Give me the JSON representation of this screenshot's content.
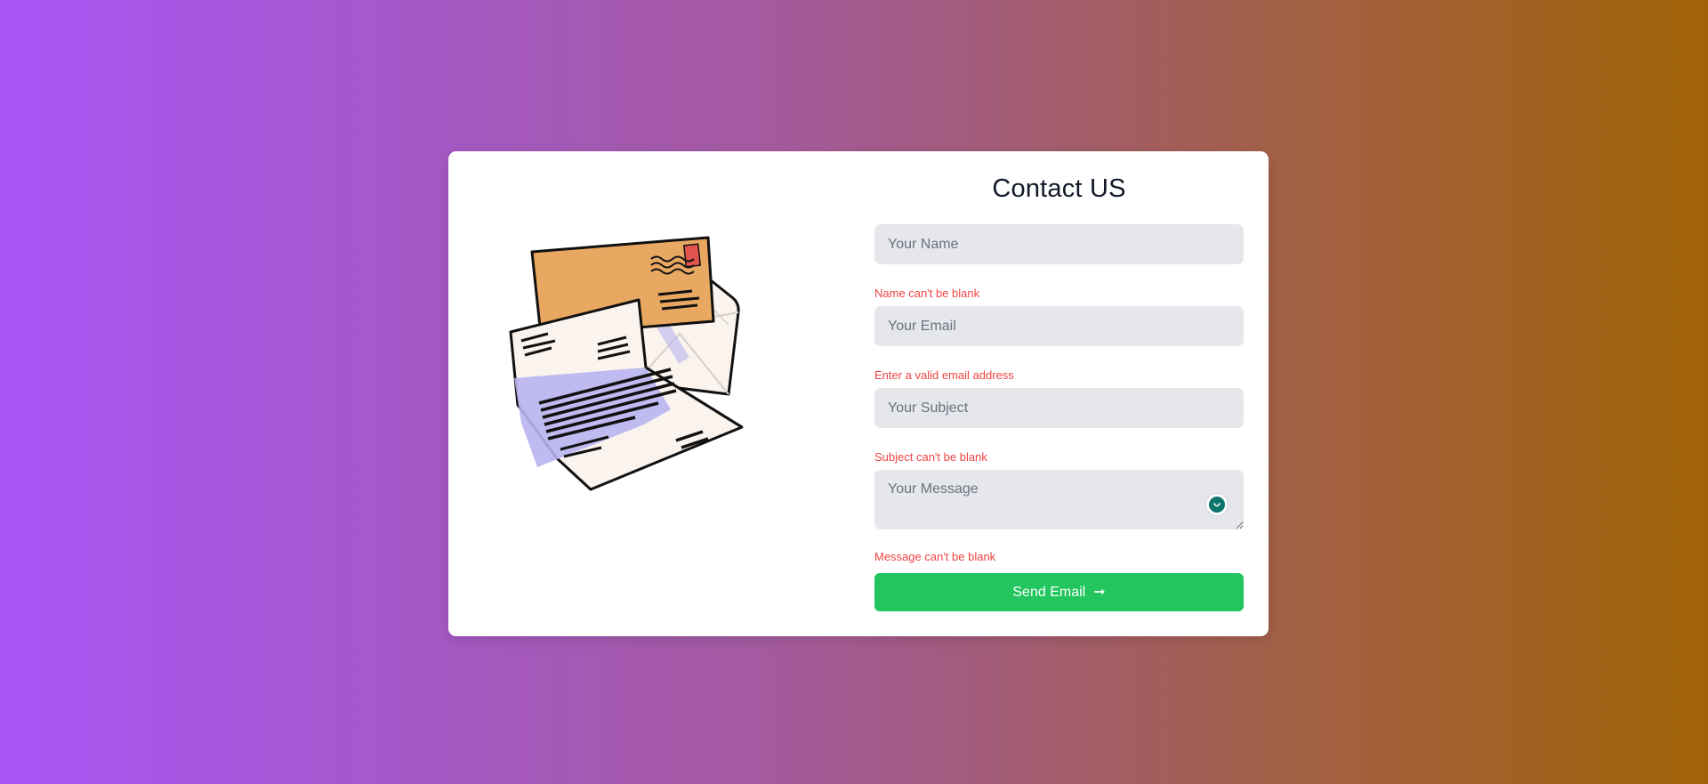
{
  "form": {
    "title": "Contact US",
    "fields": {
      "name": {
        "placeholder": "Your Name",
        "value": "",
        "error": "Name can't be blank"
      },
      "email": {
        "placeholder": "Your Email",
        "value": "",
        "error": "Enter a valid email address"
      },
      "subject": {
        "placeholder": "Your Subject",
        "value": "",
        "error": "Subject can't be blank"
      },
      "message": {
        "placeholder": "Your Message",
        "value": "",
        "error": "Message can't be blank"
      }
    },
    "submit_label": "Send Email",
    "submit_icon": "arrow-right-icon"
  },
  "illustration": {
    "icon": "envelopes-illustration"
  },
  "colors": {
    "background_start": "#a855f7",
    "background_end": "#a16207",
    "card": "#ffffff",
    "field_bg": "#e5e7eb",
    "error": "#ef4444",
    "button": "#22c55e",
    "title": "#111827",
    "envelope_orange": "#e8a862",
    "paper": "#faf3ee",
    "shadow_blue": "#b8b4f0"
  }
}
